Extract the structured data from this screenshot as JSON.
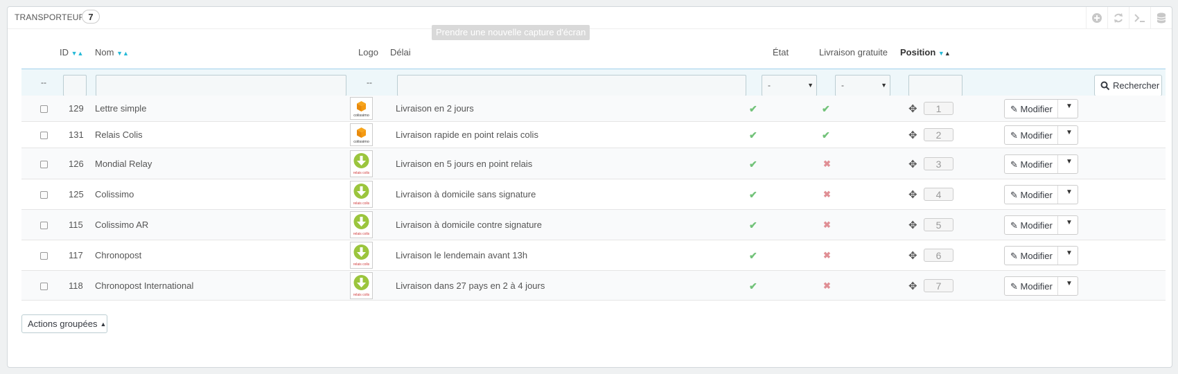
{
  "panel": {
    "title": "Transporteurs",
    "count": "7",
    "tooltip": "Prendre une nouvelle capture d'écran",
    "toolbar_icons": [
      "add-icon",
      "refresh-icon",
      "terminal-icon",
      "database-icon"
    ]
  },
  "headers": {
    "id": "ID",
    "name": "Nom",
    "logo": "Logo",
    "delay": "Délai",
    "status": "État",
    "free": "Livraison gratuite",
    "position": "Position"
  },
  "filters": {
    "dash_left": "--",
    "dash_logo": "--",
    "status_select": "-",
    "free_select": "-",
    "search_label": "Rechercher"
  },
  "rows": [
    {
      "id": "129",
      "name": "Lettre simple",
      "logo": "colissimo",
      "logo_text": "colissimo",
      "delay": "Livraison en 2 jours",
      "active": true,
      "free": true,
      "position": "1"
    },
    {
      "id": "131",
      "name": "Relais Colis",
      "logo": "colissimo",
      "logo_text": "colissimo",
      "delay": "Livraison rapide en point relais colis",
      "active": true,
      "free": true,
      "position": "2"
    },
    {
      "id": "126",
      "name": "Mondial Relay",
      "logo": "relais",
      "logo_text": "relais colis",
      "delay": "Livraison en 5 jours en point relais",
      "active": true,
      "free": false,
      "position": "3"
    },
    {
      "id": "125",
      "name": "Colissimo",
      "logo": "relais",
      "logo_text": "relais colis",
      "delay": "Livraison à domicile sans signature",
      "active": true,
      "free": false,
      "position": "4"
    },
    {
      "id": "115",
      "name": "Colissimo AR",
      "logo": "relais",
      "logo_text": "relais colis",
      "delay": "Livraison à domicile contre signature",
      "active": true,
      "free": false,
      "position": "5"
    },
    {
      "id": "117",
      "name": "Chronopost",
      "logo": "relais",
      "logo_text": "relais colis",
      "delay": "Livraison le lendemain avant 13h",
      "active": true,
      "free": false,
      "position": "6"
    },
    {
      "id": "118",
      "name": "Chronopost International",
      "logo": "relais",
      "logo_text": "relais colis",
      "delay": "Livraison dans 27 pays en 2 à 4 jours",
      "active": true,
      "free": false,
      "position": "7"
    }
  ],
  "row_action": "Modifier",
  "bulk_actions": "Actions groupées",
  "colors": {
    "accent": "#25b9d7",
    "ok": "#72c279",
    "ko": "#e08f95"
  }
}
